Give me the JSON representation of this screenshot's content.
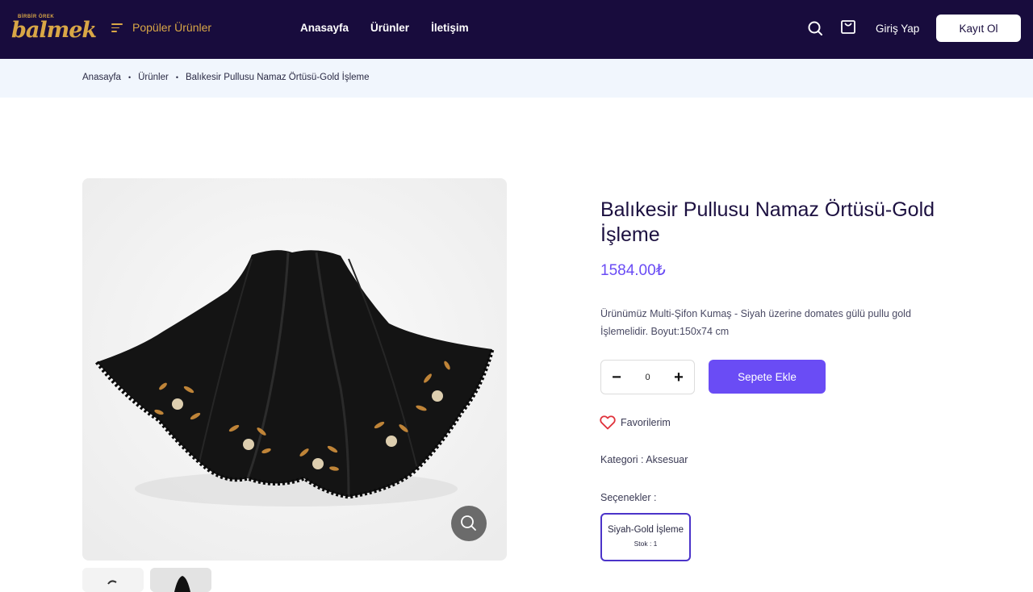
{
  "header": {
    "logo_top": "BİRBİR ÖREK",
    "logo_text": "balmek",
    "popular_label": "Popüler Ürünler",
    "nav": [
      "Anasayfa",
      "Ürünler",
      "İletişim"
    ],
    "login_label": "Giriş Yap",
    "register_label": "Kayıt Ol"
  },
  "breadcrumb": {
    "items": [
      "Anasayfa",
      "Ürünler",
      "Balıkesir Pullusu Namaz Örtüsü-Gold İşleme"
    ],
    "separator": "•"
  },
  "product": {
    "title": "Balıkesir Pullusu Namaz Örtüsü-Gold İşleme",
    "price": "1584.00₺",
    "description": "Ürünümüz Multi-Şifon Kumaş - Siyah üzerine domates gülü pullu gold İşlemelidir. Boyut:150x74 cm",
    "quantity": "0",
    "add_to_cart_label": "Sepete Ekle",
    "favorites_label": "Favorilerim",
    "category_text": "Kategori : Aksesuar",
    "options_label": "Seçenekler :",
    "option": {
      "name": "Siyah-Gold İşleme",
      "stock": "Stok : 1"
    }
  },
  "icons": {
    "menu": "menu-lines-icon",
    "search": "search-icon",
    "cart": "shopping-bag-icon",
    "minus": "minus-icon",
    "plus": "plus-icon",
    "heart": "heart-icon",
    "zoom": "zoom-icon"
  },
  "colors": {
    "header_bg": "#180c3d",
    "accent_gold": "#d9a746",
    "primary": "#6a4cf5",
    "option_border": "#4b34c9",
    "heart": "#e0333c"
  }
}
